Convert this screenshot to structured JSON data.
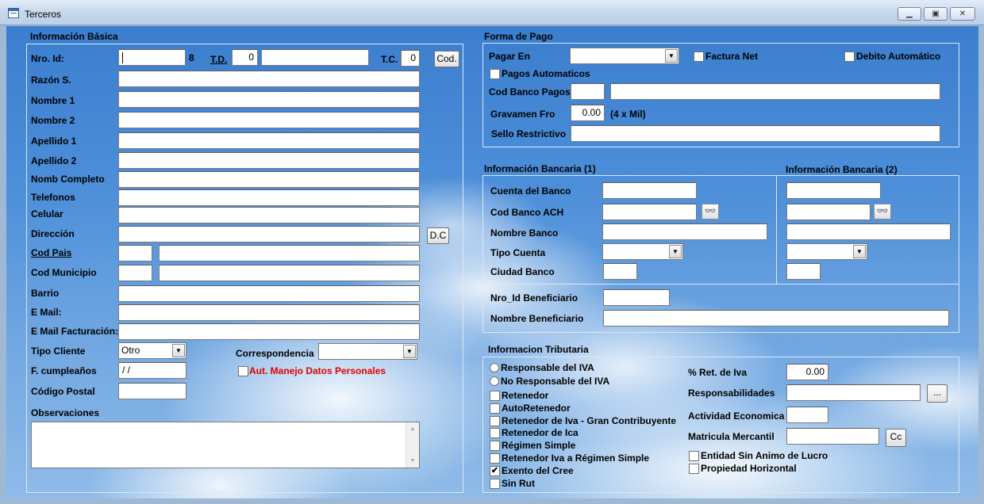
{
  "window": {
    "title": "Terceros",
    "minimize_icon": "minimize-icon",
    "maximize_icon": "maximize-icon",
    "close_icon": "close-icon",
    "min_glyph": "▁",
    "max_glyph": "▣",
    "close_glyph": "✕"
  },
  "basic": {
    "title": "Información Básica",
    "nro_id": "Nro. Id:",
    "dv": "8",
    "td": "T.D.",
    "td_value": "0",
    "tc": "T.C.",
    "tc_value": "0",
    "cod_button": "Cod.",
    "razon": "Razón S.",
    "nombre1": "Nombre 1",
    "nombre2": "Nombre 2",
    "apellido1": "Apellido 1",
    "apellido2": "Apellido 2",
    "nomb_completo": "Nomb Completo",
    "telefonos": "Telefonos",
    "celular": "Celular",
    "direccion": "Dirección",
    "dc_button": "D.C",
    "cod_pais": "Cod Pais",
    "cod_municipio": "Cod Municipio",
    "barrio": "Barrio",
    "email": "E Mail:",
    "email_fact": "E Mail Facturación:",
    "tipo_cliente": "Tipo Cliente",
    "tipo_cliente_value": "Otro",
    "correspondencia": "Correspondencia",
    "cumple": "F. cumpleaños",
    "cumple_value": " / /",
    "aut": "Aut. Manejo Datos Personales",
    "codigo_postal": "Código Postal",
    "observaciones": "Observaciones",
    "arrow_glyph": "▼",
    "scroll_up": "▲",
    "scroll_down": "▼"
  },
  "pago": {
    "title": "Forma de Pago",
    "pagar_en": "Pagar En",
    "factura_net": "Factura Net",
    "debito": "Debito Automático",
    "pagos_auto": "Pagos Automaticos",
    "cod_banco": "Cod Banco Pagos",
    "gravamen": "Gravamen Fro",
    "gravamen_value": "0.00",
    "gravamen_note": "(4 x Mil)",
    "sello": "Sello Restrictivo"
  },
  "bancaria": {
    "title1": "Información Bancaria (1)",
    "title2": "Información Bancaria (2)",
    "cuenta": "Cuenta del Banco",
    "cod_ach": "Cod Banco ACH",
    "nombre_banco": "Nombre Banco",
    "tipo_cuenta": "Tipo Cuenta",
    "ciudad": "Ciudad Banco",
    "nro_benef": "Nro_Id Beneficiario",
    "nombre_benef": "Nombre Beneficiario",
    "binoc_glyph": "👓"
  },
  "tributaria": {
    "title": "Informacion Tributaria",
    "responsable": "Responsable del IVA",
    "no_responsable": "No Responsable del IVA",
    "options": [
      {
        "label": "Retenedor",
        "checked": false,
        "mark": ""
      },
      {
        "label": "AutoRetenedor",
        "checked": false,
        "mark": ""
      },
      {
        "label": "Retenedor de Iva - Gran Contribuyente",
        "checked": false,
        "mark": ""
      },
      {
        "label": "Retenedor de Ica",
        "checked": false,
        "mark": ""
      },
      {
        "label": "Régimen Simple",
        "checked": false,
        "mark": ""
      },
      {
        "label": "Retenedor Iva a Régimen Simple",
        "checked": false,
        "mark": ""
      },
      {
        "label": "Exento del Cree",
        "checked": true,
        "mark": "✔"
      },
      {
        "label": "Sin Rut",
        "checked": false,
        "mark": ""
      }
    ],
    "ret_iva": "% Ret. de Iva",
    "ret_iva_value": "0.00",
    "responsabilidades": "Responsabilidades",
    "dots_button": "...",
    "actividad": "Actividad Economica",
    "matricula": "Matricula Mercantil",
    "cc_button": "Cc",
    "entidad": "Entidad Sin Animo de Lucro",
    "propiedad": "Propiedad Horizontal"
  }
}
